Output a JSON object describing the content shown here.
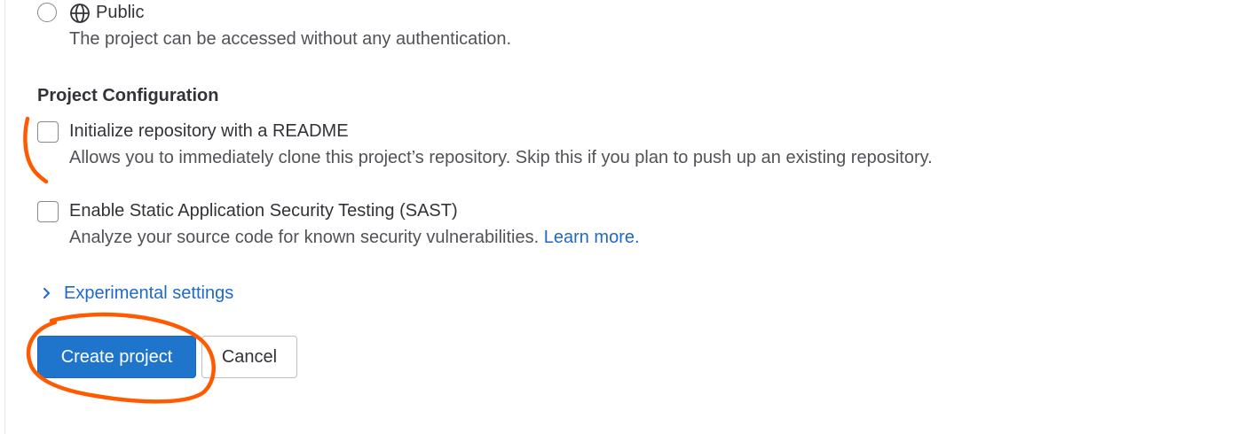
{
  "visibility": {
    "public": {
      "label": "Public",
      "icon": "globe-icon",
      "description": "The project can be accessed without any authentication."
    }
  },
  "config": {
    "heading": "Project Configuration",
    "readme": {
      "label": "Initialize repository with a README",
      "description": "Allows you to immediately clone this project’s repository. Skip this if you plan to push up an existing repository."
    },
    "sast": {
      "label": "Enable Static Application Security Testing (SAST)",
      "description": "Analyze your source code for known security vulnerabilities.",
      "link": "Learn more."
    }
  },
  "experimental": {
    "label": "Experimental settings",
    "icon": "chevron-right-icon"
  },
  "actions": {
    "create": "Create project",
    "cancel": "Cancel"
  },
  "colors": {
    "primary": "#1f75cb",
    "link": "#1f69c8",
    "annotation": "#ff5a00"
  }
}
